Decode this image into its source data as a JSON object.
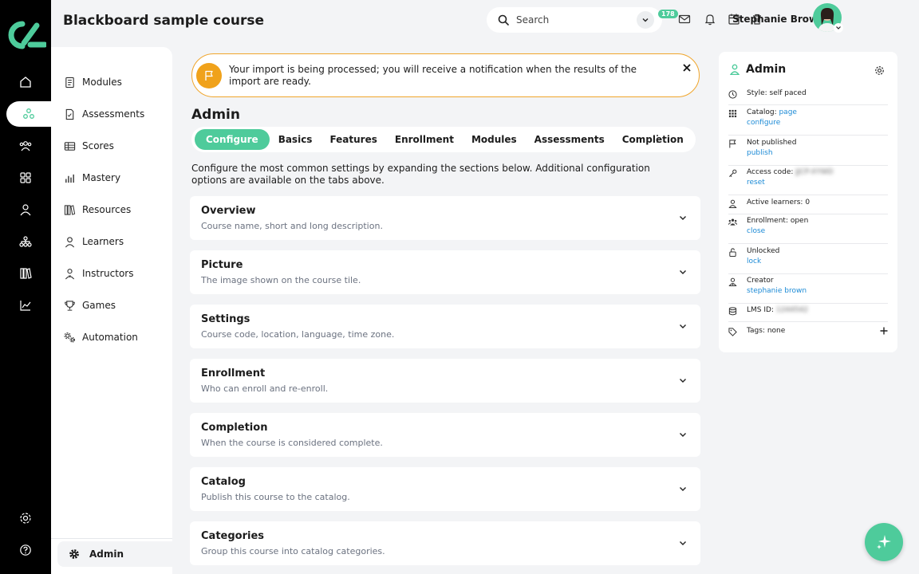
{
  "colors": {
    "accent": "#4ecb9b",
    "warning": "#f0a21b",
    "link": "#1d8bd6",
    "rail": "#000000"
  },
  "rail": {
    "icons": [
      "home-icon",
      "course-icon",
      "people-icon",
      "grid-icon",
      "person-icon",
      "org-icon",
      "library-icon",
      "chart-icon"
    ],
    "bottom_icons": [
      "settings-icon",
      "help-icon"
    ]
  },
  "header": {
    "title": "Blackboard sample course",
    "search_placeholder": "Search",
    "notification_count": "178",
    "user_name": "Stephanie Brown"
  },
  "nav": {
    "items": [
      {
        "label": "Modules",
        "icon": "modules-icon"
      },
      {
        "label": "Assessments",
        "icon": "assessments-icon"
      },
      {
        "label": "Scores",
        "icon": "scores-icon"
      },
      {
        "label": "Mastery",
        "icon": "mastery-icon"
      },
      {
        "label": "Resources",
        "icon": "resources-icon"
      },
      {
        "label": "Learners",
        "icon": "learners-icon"
      },
      {
        "label": "Instructors",
        "icon": "instructors-icon"
      },
      {
        "label": "Games",
        "icon": "games-icon"
      },
      {
        "label": "Automation",
        "icon": "automation-icon"
      }
    ],
    "admin_label": "Admin"
  },
  "notice": {
    "text": "Your import is being processed; you will receive a notification when the results of the import are ready."
  },
  "main": {
    "title": "Admin",
    "tabs": [
      "Configure",
      "Basics",
      "Features",
      "Enrollment",
      "Modules",
      "Assessments",
      "Completion"
    ],
    "active_tab": "Configure",
    "intro": "Configure the most common settings by expanding the sections below. Additional configuration options are available on the tabs above.",
    "sections": [
      {
        "title": "Overview",
        "desc": "Course name, short and long description."
      },
      {
        "title": "Picture",
        "desc": "The image shown on the course tile."
      },
      {
        "title": "Settings",
        "desc": "Course code, location, language, time zone."
      },
      {
        "title": "Enrollment",
        "desc": "Who can enroll and re-enroll."
      },
      {
        "title": "Completion",
        "desc": "When the course is considered complete."
      },
      {
        "title": "Catalog",
        "desc": "Publish this course to the catalog."
      },
      {
        "title": "Categories",
        "desc": "Group this course into catalog categories."
      }
    ]
  },
  "side": {
    "title": "Admin",
    "style": "Style: self paced",
    "catalog_prefix": "Catalog: ",
    "catalog_link": "page",
    "catalog_action": "configure",
    "publish_status": "Not published",
    "publish_action": "publish",
    "access_code_label": "Access code: ",
    "access_code_value": "JJCP-XYWD",
    "access_code_action": "reset",
    "active_learners": "Active learners: 0",
    "enrollment_status": "Enrollment: open",
    "enrollment_action": "close",
    "lock_status": "Unlocked",
    "lock_action": "lock",
    "creator_label": "Creator",
    "creator_name": "stephanie brown",
    "lms_id_label": "LMS ID: ",
    "lms_id_value": "1244542",
    "tags": "Tags: none"
  }
}
